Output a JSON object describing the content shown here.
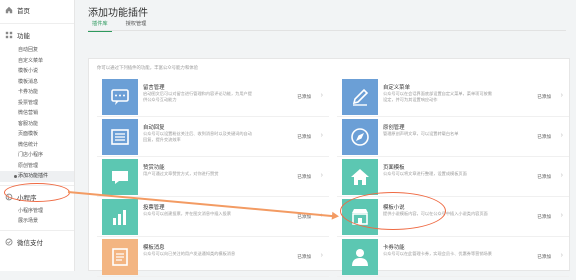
{
  "sidebar": {
    "home": "首页",
    "section_function": "功能",
    "function_items": [
      "自动回复",
      "自定义菜单",
      "模板小说",
      "模板消息",
      "卡券功能",
      "投票管理",
      "微信营销",
      "客服功能",
      "页面模板",
      "微信统计",
      "门店小程序",
      "原创管理",
      "添加功能插件"
    ],
    "section_miniprogram": "小程序",
    "miniprogram_items": [
      "小程序管理",
      "展示场景"
    ],
    "section_pay": "微信支付"
  },
  "main": {
    "title": "添加功能插件",
    "tabs": [
      "插件库",
      "授权管理"
    ],
    "hint": "你可以通过下列插件的功能，丰富公众号能力和体验",
    "cards": [
      {
        "title": "留言管理",
        "desc": "启动图文后可以对留言进行管理和内容评论功能，为用户提供公众号互动能力",
        "state": "已添加",
        "icon": "chat-icon",
        "color": "#6b9fd6"
      },
      {
        "title": "自定义菜单",
        "desc": "公众号可以在会话界面底部设置自定义菜单，菜单项可按需设定，并可为其设置响应动作",
        "state": "已添加",
        "icon": "pencil-icon",
        "color": "#6b9fd6"
      },
      {
        "title": "自动回复",
        "desc": "公众号可以设置粉丝关注后、收到消息时以及关键词的自动回复，提升交流效率",
        "state": "已添加",
        "icon": "list-icon",
        "color": "#6b9fd6"
      },
      {
        "title": "原创管理",
        "desc": "管理原创声明文章，可以设置转载白名单",
        "state": "已添加",
        "icon": "compass-icon",
        "color": "#6b9fd6"
      },
      {
        "title": "赞赏功能",
        "desc": "用户可通过文章赞赏方式，对你进行赞赏",
        "state": "已添加",
        "icon": "chat-icon",
        "color": "#5cc7b2"
      },
      {
        "title": "页面模板",
        "desc": "公众号可以将文章进行整理，设置成模板页面",
        "state": "已添加",
        "icon": "home-icon",
        "color": "#5cc7b2"
      },
      {
        "title": "投票管理",
        "desc": "公众号可以创建投票，并在图文消息中插入投票",
        "state": "已添加",
        "icon": "bar-chart-icon",
        "color": "#5cc7b2"
      },
      {
        "title": "模板小说",
        "desc": "提供小说模板内容，可以在公众号中插入小说类内容页面",
        "state": "已添加",
        "icon": "store-icon",
        "color": "#5cc7b2"
      },
      {
        "title": "模板消息",
        "desc": "公众号可以向已关注的用户发送通知类的模板消息",
        "state": "已添加",
        "icon": "doc-icon",
        "color": "#f3b582"
      },
      {
        "title": "卡券功能",
        "desc": "公众号可以在此管理卡券，实现会员卡、优惠券等营销场景",
        "state": "已添加",
        "icon": "person-icon",
        "color": "#5cc7b2"
      }
    ]
  },
  "colors": {
    "accent": "#2e9a5e",
    "highlight": "#ef6a43",
    "arrow": "#f39b63"
  }
}
